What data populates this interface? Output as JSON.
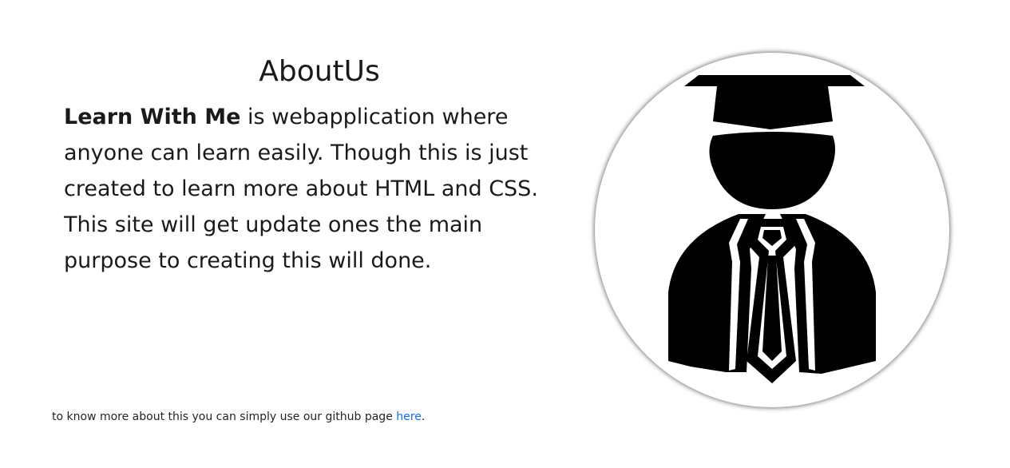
{
  "about": {
    "title": "AboutUs",
    "brand_name": "Learn With Me",
    "description": " is webapplication where anyone can learn easily. Though this is just created to learn more about HTML and CSS. This site will get update ones the main purpose to creating this will done."
  },
  "graduate_image": {
    "icon": "graduate-icon"
  },
  "footer": {
    "text": "to know more about this you can simply use our github page ",
    "link_label": "here",
    "trailing": "."
  }
}
